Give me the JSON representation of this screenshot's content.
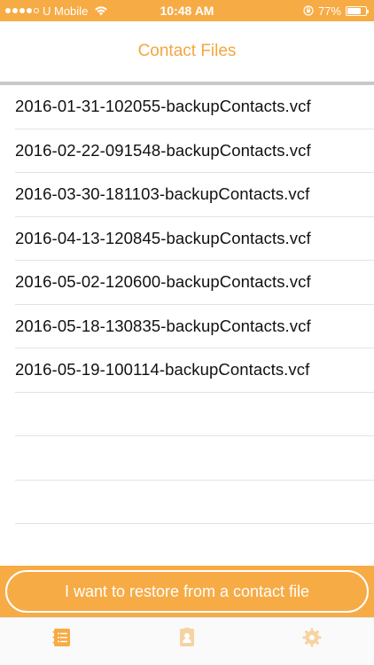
{
  "status_bar": {
    "carrier": "U Mobile",
    "time": "10:48 AM",
    "battery": "77%",
    "battery_level": 0.77,
    "signal_bars_filled": 4,
    "signal_bars_total": 5
  },
  "nav": {
    "title": "Contact Files"
  },
  "files": [
    "2016-01-31-102055-backupContacts.vcf",
    "2016-02-22-091548-backupContacts.vcf",
    "2016-03-30-181103-backupContacts.vcf",
    "2016-04-13-120845-backupContacts.vcf",
    "2016-05-02-120600-backupContacts.vcf",
    "2016-05-18-130835-backupContacts.vcf",
    "2016-05-19-100114-backupContacts.vcf"
  ],
  "restore": {
    "label": "I want to restore from a contact file"
  },
  "tabs": [
    {
      "icon": "contacts-list-icon",
      "active": true
    },
    {
      "icon": "contact-card-icon",
      "active": false
    },
    {
      "icon": "gear-icon",
      "active": false
    }
  ],
  "colors": {
    "accent": "#f7ab45",
    "title": "#f3a640",
    "tab_inactive": "#f6d3a3"
  }
}
